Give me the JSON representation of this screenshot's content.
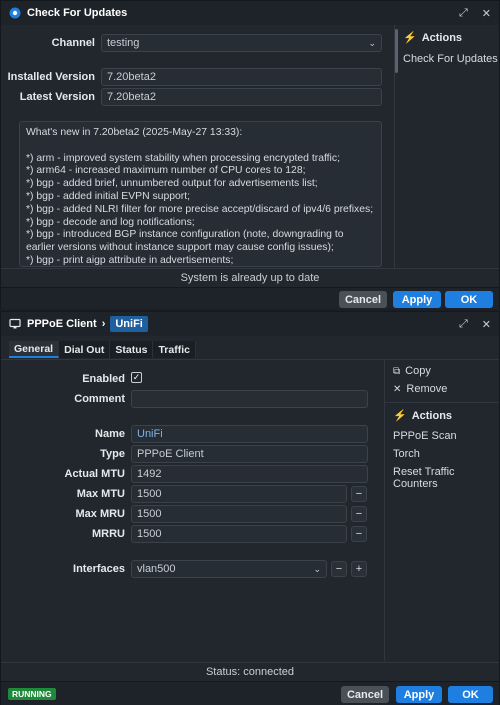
{
  "updates": {
    "title": "Check For Updates",
    "channel_label": "Channel",
    "channel_value": "testing",
    "installed_label": "Installed Version",
    "installed_value": "7.20beta2",
    "latest_label": "Latest Version",
    "latest_value": "7.20beta2",
    "changelog": [
      "What's new in 7.20beta2 (2025-May-27 13:33):",
      "",
      "*) arm - improved system stability when processing encrypted traffic;",
      "*) arm64 - increased maximum number of CPU cores to 128;",
      "*) bgp - added brief, unnumbered output for advertisements list;",
      "*) bgp - added initial EVPN support;",
      "*) bgp - added NLRI filter for more precise accept/discard of ipv4/6 prefixes;",
      "*) bgp - decode and log notifications;",
      "*) bgp - introduced BGP instance configuration (note, downgrading to earlier versions without instance support may cause config issues);",
      "*) bgp - print aigp attribute in advertisements;"
    ],
    "status": "System is already up to date",
    "actions_title": "Actions",
    "actions": [
      "Check For Updates"
    ],
    "buttons": {
      "cancel": "Cancel",
      "apply": "Apply",
      "ok": "OK"
    }
  },
  "pppoe": {
    "breadcrumb_root": "PPPoE Client",
    "breadcrumb_sep": "›",
    "breadcrumb_item": "UniFi",
    "tabs": [
      "General",
      "Dial Out",
      "Status",
      "Traffic"
    ],
    "fields": {
      "enabled_label": "Enabled",
      "comment_label": "Comment",
      "comment_value": "",
      "name_label": "Name",
      "name_value": "UniFi",
      "type_label": "Type",
      "type_value": "PPPoE Client",
      "actual_mtu_label": "Actual MTU",
      "actual_mtu_value": "1492",
      "max_mtu_label": "Max MTU",
      "max_mtu_value": "1500",
      "max_mru_label": "Max MRU",
      "max_mru_value": "1500",
      "mrru_label": "MRRU",
      "mrru_value": "1500",
      "interfaces_label": "Interfaces",
      "interfaces_value": "vlan500"
    },
    "side": {
      "copy": "Copy",
      "remove": "Remove",
      "actions_title": "Actions",
      "actions": [
        "PPPoE Scan",
        "Torch",
        "Reset Traffic Counters"
      ]
    },
    "status": "Status: connected",
    "running_badge": "RUNNING",
    "buttons": {
      "cancel": "Cancel",
      "apply": "Apply",
      "ok": "OK"
    }
  }
}
